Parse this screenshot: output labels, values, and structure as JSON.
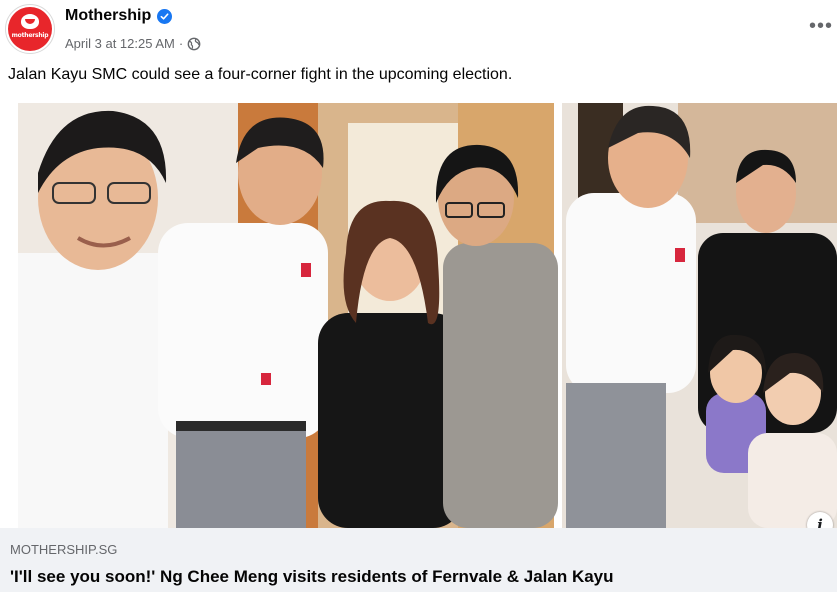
{
  "post": {
    "page_name": "Mothership",
    "verified": true,
    "timestamp": "April 3 at 12:25 AM",
    "separator": "·",
    "audience_icon": "globe-icon",
    "more_icon": "more-horizontal-icon",
    "more_label": "•••",
    "caption": "Jalan Kayu SMC could see a four-corner fight in the upcoming election."
  },
  "avatar": {
    "logo_text": "mothership",
    "brand_color": "#e8262b"
  },
  "link_card": {
    "domain": "MOTHERSHIP.SG",
    "title": "'I'll see you soon!' Ng Chee Meng visits residents of Fernvale & Jalan Kayu",
    "info_icon": "info-icon",
    "info_label": "i"
  },
  "colors": {
    "verified_blue": "#1877f2",
    "secondary_text": "#65676b",
    "card_background": "#f0f2f5"
  }
}
